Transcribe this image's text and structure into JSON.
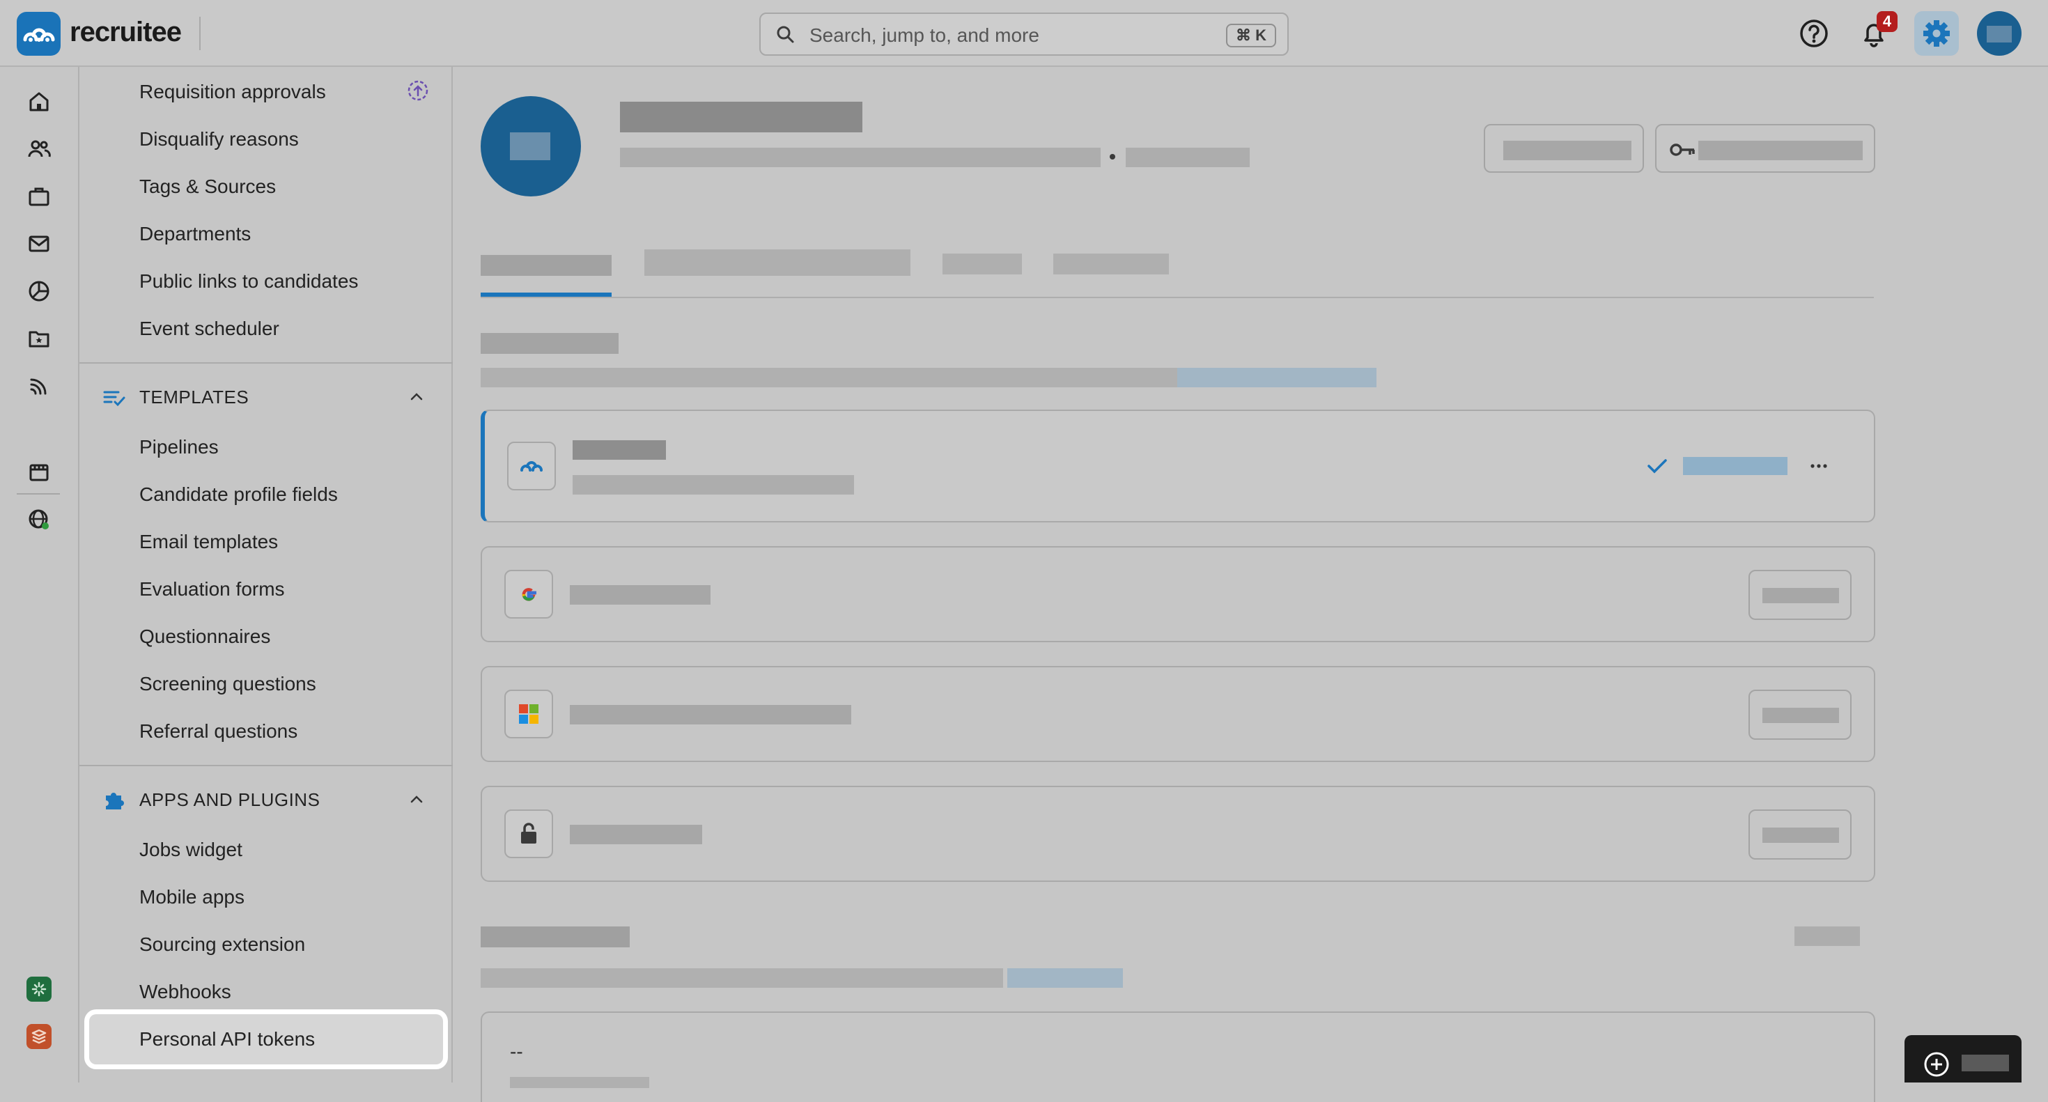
{
  "brand": {
    "name": "recruitee"
  },
  "search": {
    "placeholder": "Search, jump to, and more",
    "shortcut": "⌘ K"
  },
  "header": {
    "notification_count": "4"
  },
  "rail": {
    "icons": [
      "home-icon",
      "candidates-icon",
      "jobs-icon",
      "mail-icon",
      "reports-icon",
      "folder-star-icon",
      "feed-icon",
      "careers-site-icon",
      "globe-icon"
    ]
  },
  "settings_nav": {
    "items_top": [
      "Requisition approvals",
      "Disqualify reasons",
      "Tags & Sources",
      "Departments",
      "Public links to candidates",
      "Event scheduler"
    ],
    "templates": {
      "heading": "TEMPLATES",
      "items": [
        "Pipelines",
        "Candidate profile fields",
        "Email templates",
        "Evaluation forms",
        "Questionnaires",
        "Screening questions",
        "Referral questions"
      ]
    },
    "apps": {
      "heading": "APPS AND PLUGINS",
      "items": [
        "Jobs widget",
        "Mobile apps",
        "Sourcing extension",
        "Webhooks",
        "Personal API tokens"
      ],
      "active": "Personal API tokens"
    }
  },
  "main": {
    "placeholder_text": "--"
  },
  "colors": {
    "accent": "#1b75bb",
    "badge": "#b41e1e",
    "active_highlight": "#ffffff"
  }
}
